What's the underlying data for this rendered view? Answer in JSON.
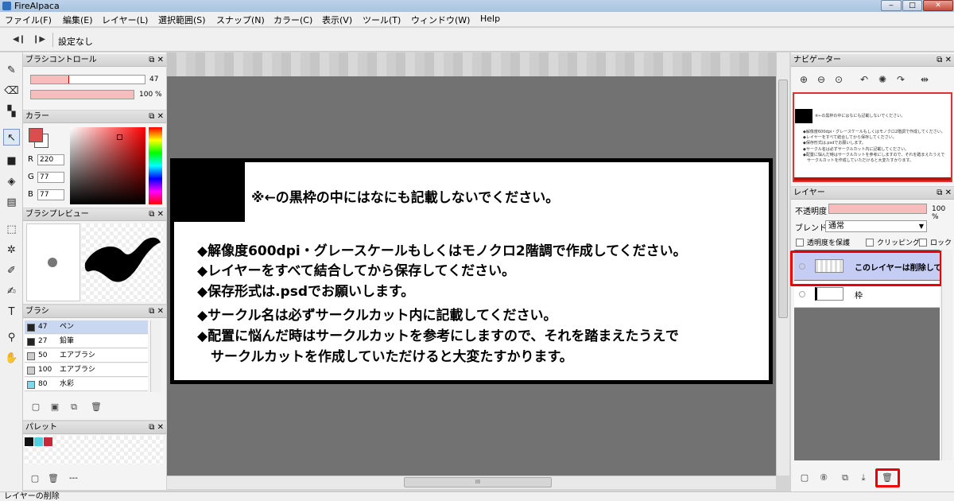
{
  "window": {
    "title": "FireAlpaca",
    "buttons": {
      "minimize": "‒",
      "maximize": "□",
      "close": "✕"
    }
  },
  "menu": [
    "ファイル(F)",
    "編集(E)",
    "レイヤー(L)",
    "選択範囲(S)",
    "スナップ(N)",
    "カラー(C)",
    "表示(V)",
    "ツール(T)",
    "ウィンドウ(W)",
    "Help"
  ],
  "toolbar": {
    "prev_icon": "◀❙",
    "next_icon": "❙▶",
    "text": "設定なし"
  },
  "brush_control": {
    "title": "ブラシコントロール",
    "size_value": "47",
    "size_fraction": 0.33,
    "opacity_value": "100 %",
    "opacity_fraction": 1.0
  },
  "color_panel": {
    "title": "カラー",
    "foreground": "#dc4d4d",
    "r_label": "R",
    "r": "220",
    "g_label": "G",
    "g": "77",
    "b_label": "B",
    "b": "77"
  },
  "brush_preview": {
    "title": "ブラシプレビュー"
  },
  "brush_panel": {
    "title": "ブラシ",
    "items": [
      {
        "size": "47",
        "name": "ペン",
        "color": "#222222",
        "selected": true
      },
      {
        "size": "27",
        "name": "鉛筆",
        "color": "#222222",
        "selected": false
      },
      {
        "size": "50",
        "name": "エアブラシ",
        "color": "#cccccc",
        "selected": false
      },
      {
        "size": "100",
        "name": "エアブラシ",
        "color": "#cccccc",
        "selected": false
      },
      {
        "size": "80",
        "name": "水彩",
        "color": "#7fd9ec",
        "selected": false
      }
    ]
  },
  "palette_panel": {
    "title": "パレット",
    "swatches": [
      "#111111",
      "#55cde6",
      "#c62839"
    ],
    "footer_text": "---"
  },
  "panel_buttons": {
    "float": "⧉",
    "close": "✕"
  },
  "canvas": {
    "heading": "※←の黒枠の中にはなにも記載しないでください。",
    "lines": [
      "◆解像度600dpi・グレースケールもしくはモノクロ2階調で作成してください。",
      "◆レイヤーをすべて結合してから保存してください。",
      "◆保存形式は.psdでお願いします。",
      "◆サークル名は必ずサークルカット内に記載してください。",
      "◆配置に悩んだ時はサークルカットを参考にしますので、それを踏まえたうえで",
      "　サークルカットを作成していただけると大変たすかります。"
    ],
    "hscroll_grip": "III"
  },
  "navigator": {
    "title": "ナビゲーター",
    "icons": [
      "zoom-in",
      "zoom-out",
      "zoom-fit",
      "rotate-left",
      "rotate-reset",
      "rotate-right",
      "flip"
    ]
  },
  "layer_panel": {
    "title": "レイヤー",
    "opacity_label": "不透明度",
    "opacity_value": "100 %",
    "blend_label": "ブレンド",
    "blend_value": "通常",
    "protect_alpha": "透明度を保護",
    "clipping": "クリッピング",
    "lock": "ロック",
    "layers": [
      {
        "name": "このレイヤーは削除して",
        "selected": true
      },
      {
        "name": "枠",
        "selected": false
      }
    ]
  },
  "status": "レイヤーの削除"
}
